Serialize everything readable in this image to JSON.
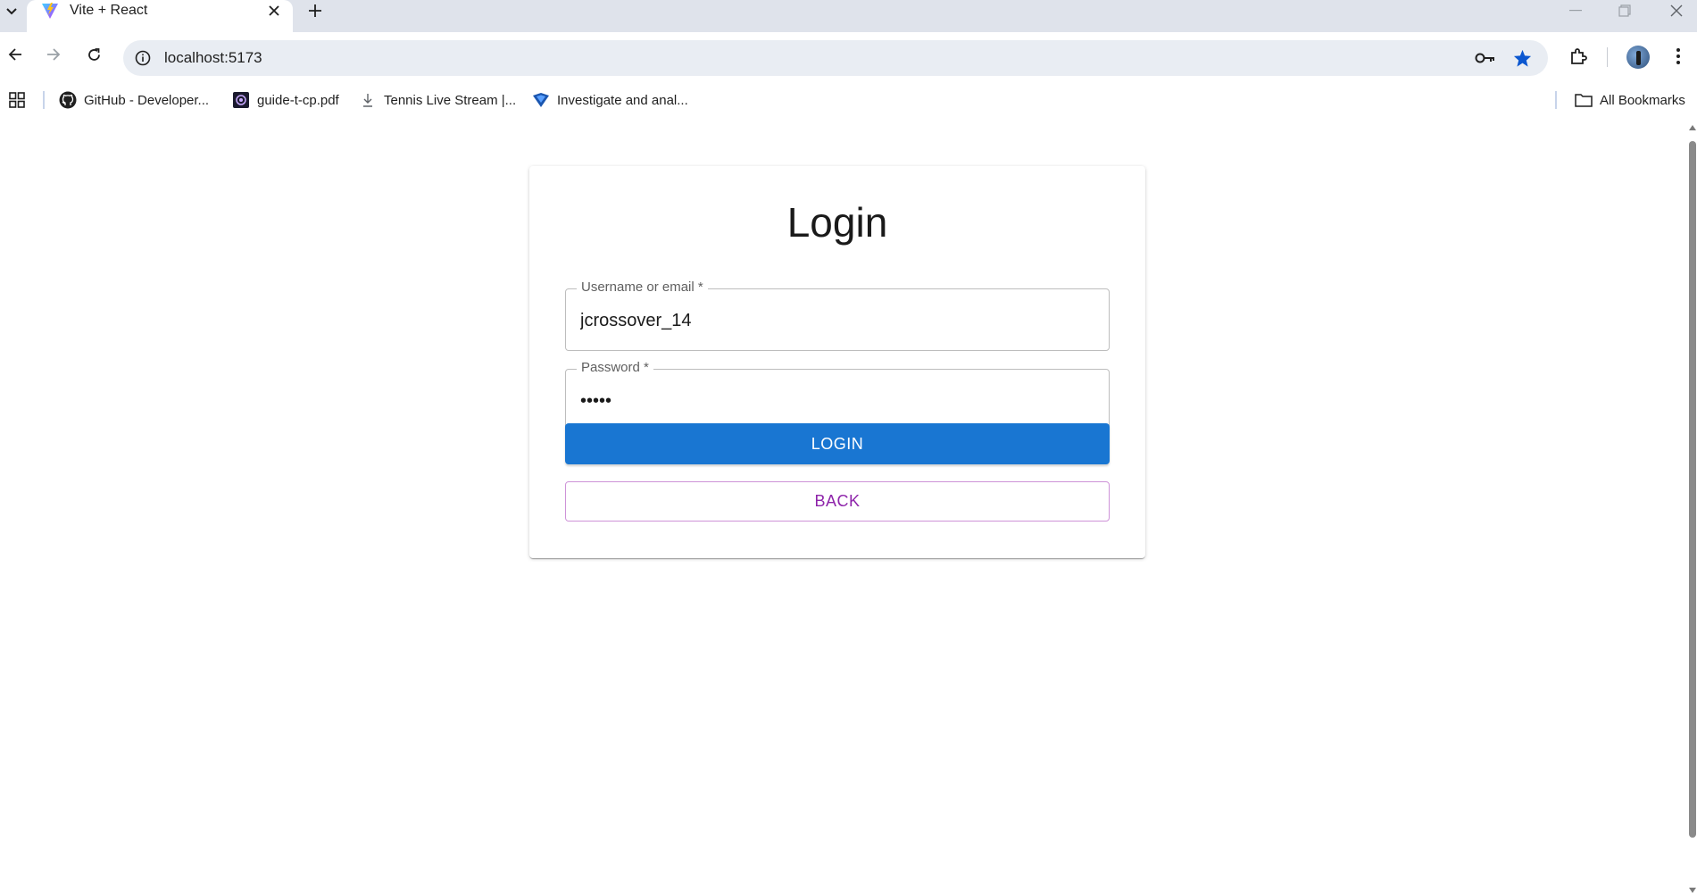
{
  "browser": {
    "tab": {
      "title": "Vite + React",
      "favicon": "vite-logo-icon"
    },
    "url": "localhost:5173",
    "bookmarks": [
      {
        "label": "GitHub - Developer...",
        "icon": "github-icon"
      },
      {
        "label": "guide-t-cp.pdf",
        "icon": "pdf-icon"
      },
      {
        "label": "Tennis Live Stream |...",
        "icon": "tennis-icon"
      },
      {
        "label": "Investigate and anal...",
        "icon": "shield-icon"
      }
    ],
    "all_bookmarks_label": "All Bookmarks",
    "colors": {
      "tabstrip": "#dfe3eb",
      "omnibox": "#e9edf3",
      "star": "#0b57d0"
    }
  },
  "login": {
    "title": "Login",
    "username": {
      "label": "Username or email *",
      "value": "jcrossover_14"
    },
    "password": {
      "label": "Password *",
      "value": "•••••"
    },
    "login_button": "LOGIN",
    "back_button": "BACK",
    "colors": {
      "primary": "#1976d2",
      "secondary": "#8e24aa"
    }
  }
}
